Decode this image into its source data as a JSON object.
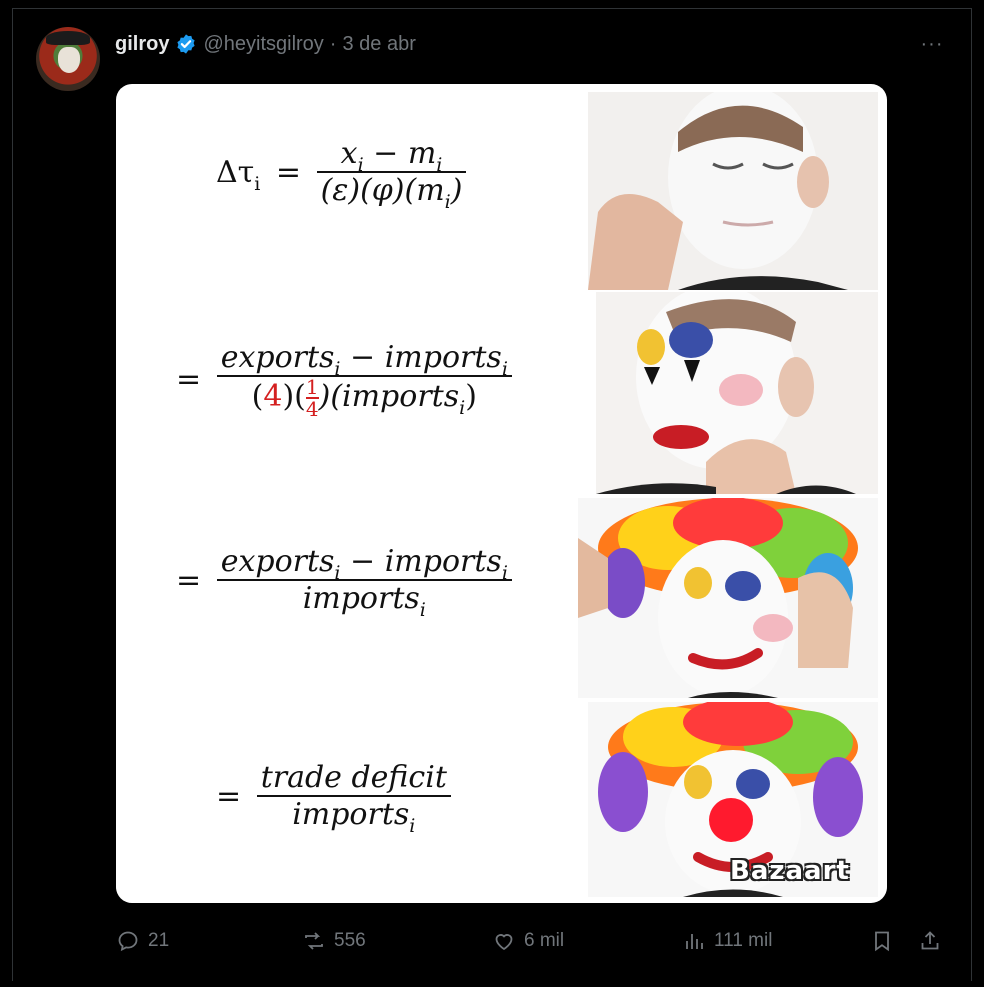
{
  "tweet": {
    "display_name": "gilroy",
    "handle": "@heyitsgilroy",
    "separator": "·",
    "date": "3 de abr",
    "more": "···"
  },
  "meme": {
    "eq1": {
      "lhs": "Δτ",
      "lhs_sub": "i",
      "eq": "=",
      "num_x": "x",
      "num_sub": "i",
      "num_minus": " − m",
      "num_sub2": "i",
      "den": "(ε)(φ)(m",
      "den_sub": "i",
      "den_close": ")"
    },
    "eq2": {
      "eq": "=",
      "num_a": "exports",
      "num_a_sub": "i",
      "num_minus": " − imports",
      "num_b_sub": "i",
      "den_open": "(",
      "den_four": "4",
      "den_mid1": ")(",
      "den_frac_num": "1",
      "den_frac_den": "4",
      "den_mid2": ")(imports",
      "den_sub": "i",
      "den_close": ")"
    },
    "eq3": {
      "eq": "=",
      "num_a": "exports",
      "num_a_sub": "i",
      "num_minus": " − imports",
      "num_b_sub": "i",
      "den": "imports",
      "den_sub": "i"
    },
    "eq4": {
      "eq": "=",
      "num": "trade deficit",
      "den": "imports",
      "den_sub": "i"
    },
    "watermark": "Bazaart"
  },
  "actions": {
    "replies": "21",
    "reposts": "556",
    "likes": "6 mil",
    "views": "111 mil"
  },
  "colors": {
    "verified": "#1d9bf0",
    "muted": "#71767b",
    "highlight_red": "#d42020"
  }
}
